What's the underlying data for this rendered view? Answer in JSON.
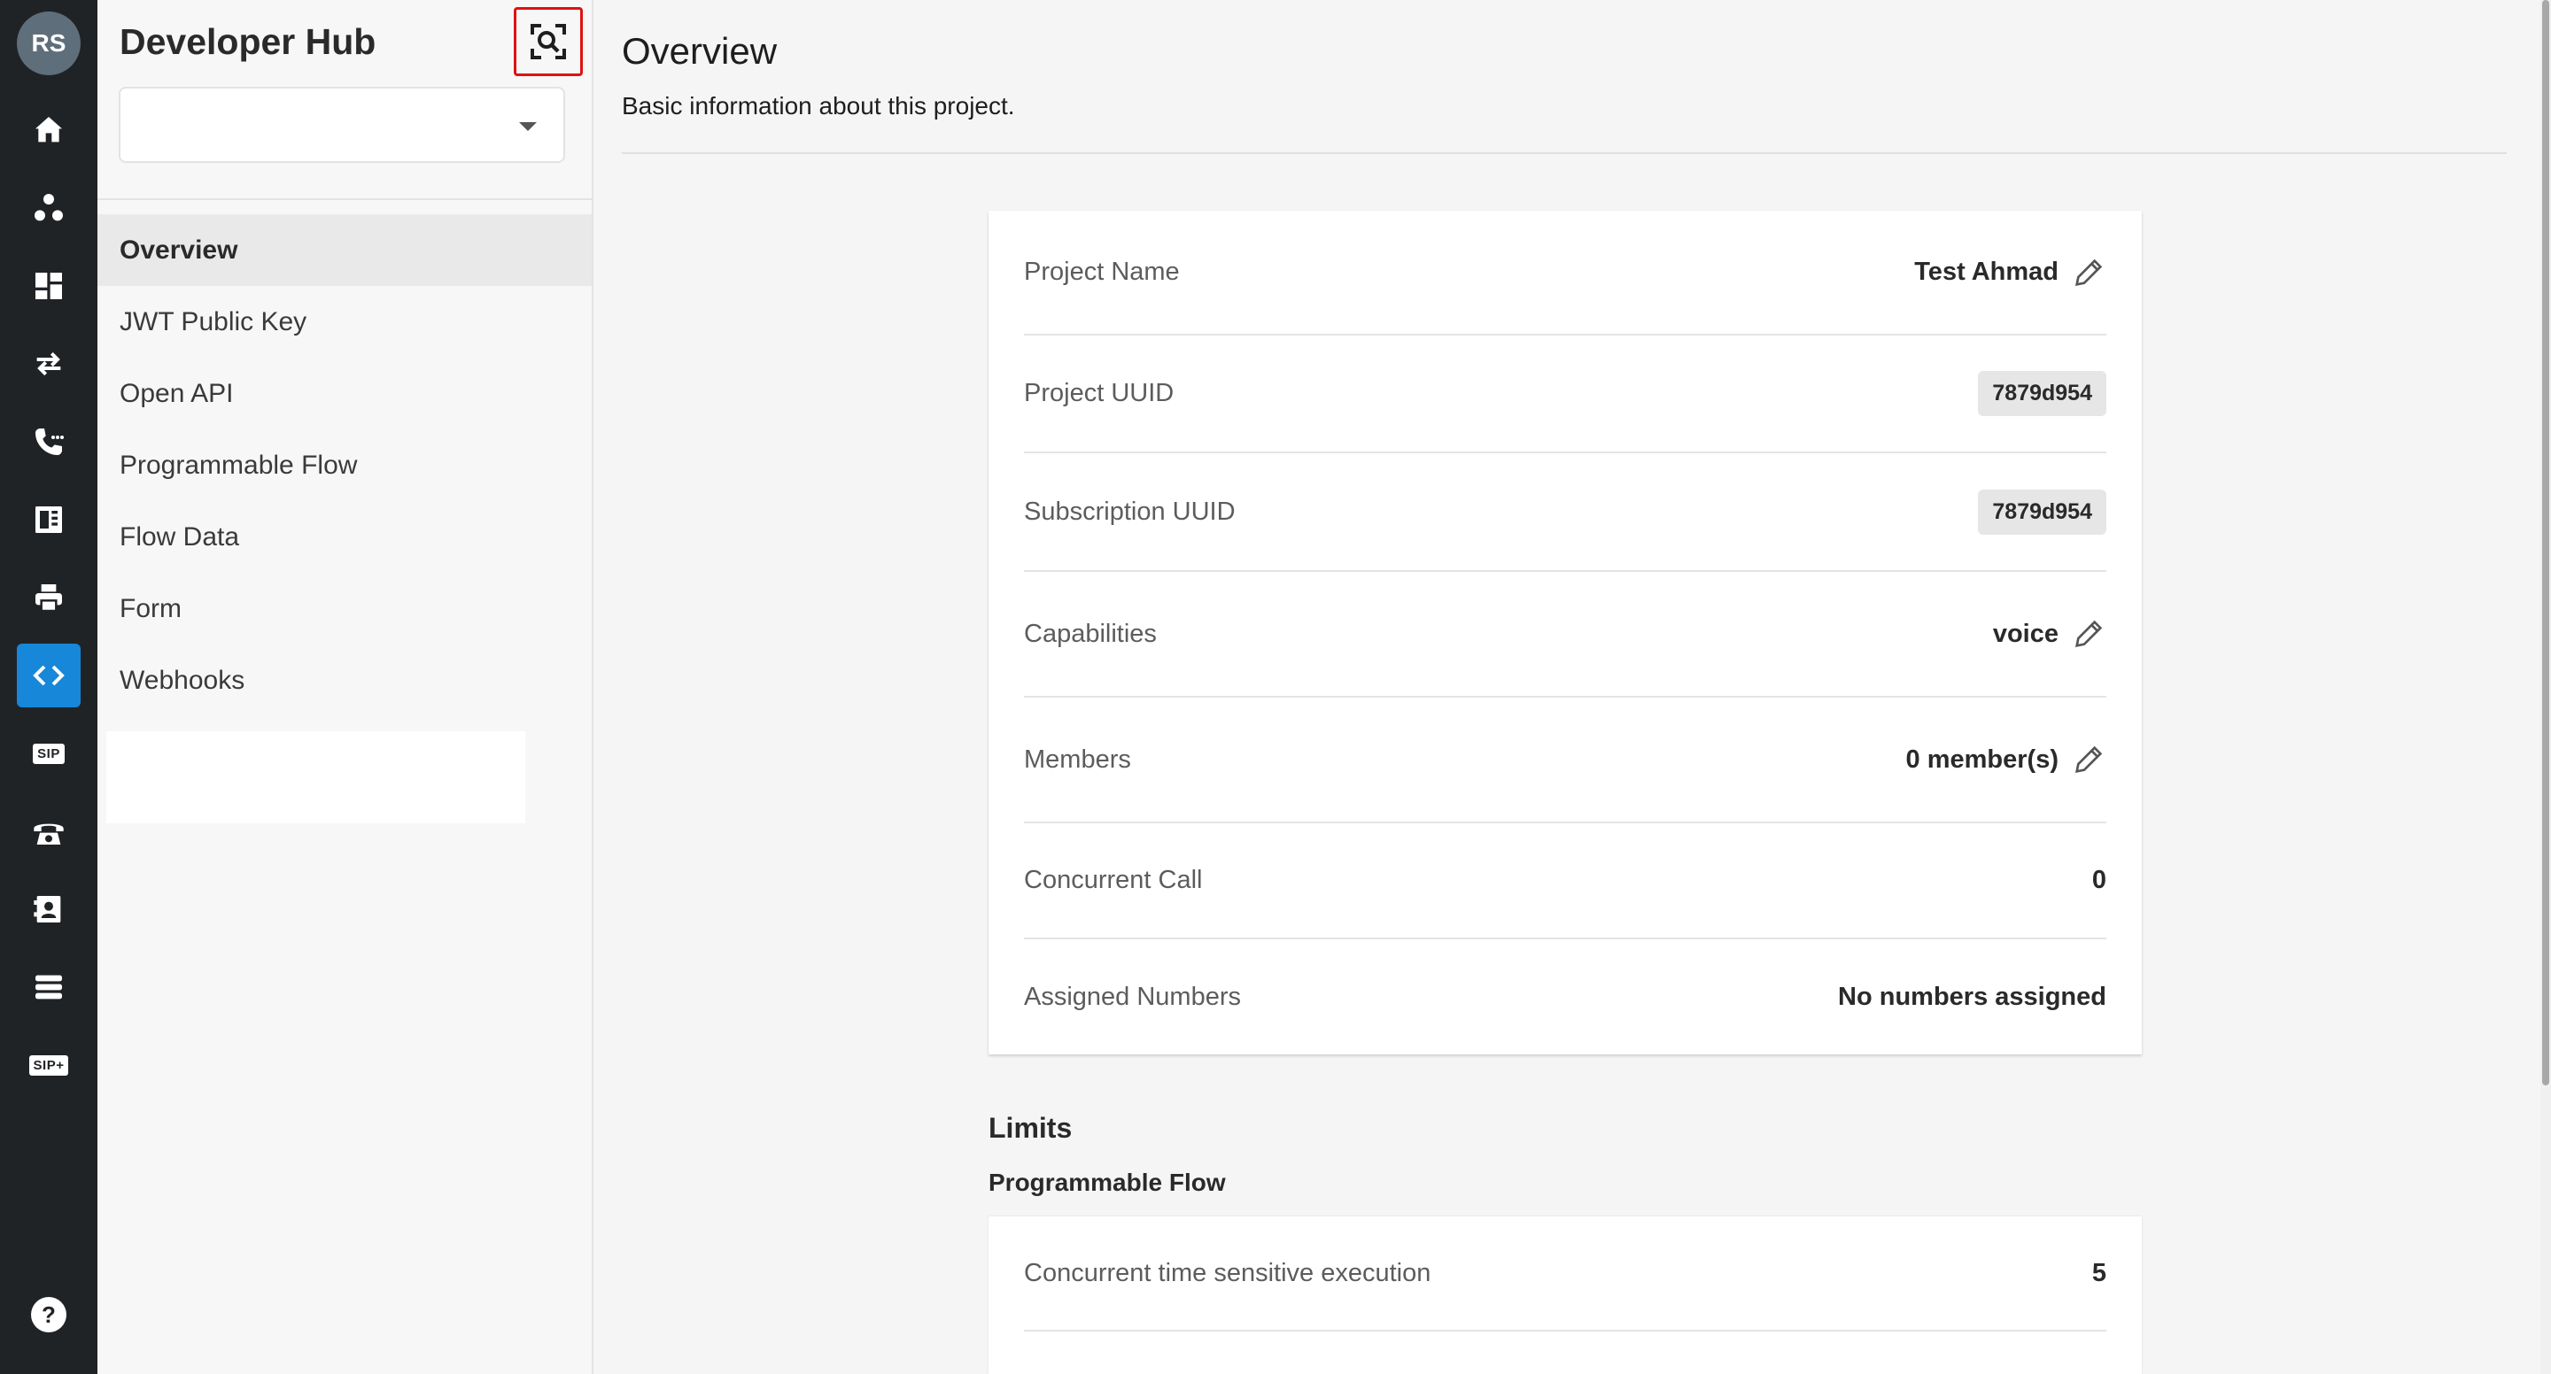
{
  "user": {
    "initials": "RS"
  },
  "rail": {
    "items": [
      {
        "name": "home-icon"
      },
      {
        "name": "group-icon"
      },
      {
        "name": "dashboard-icon"
      },
      {
        "name": "transfer-icon"
      },
      {
        "name": "phone-icon"
      },
      {
        "name": "fax-icon"
      },
      {
        "name": "printer-icon"
      },
      {
        "name": "code-icon",
        "active": true
      },
      {
        "name": "sip-icon",
        "label": "SIP"
      },
      {
        "name": "telephone-icon"
      },
      {
        "name": "contact-icon"
      },
      {
        "name": "list-icon"
      },
      {
        "name": "sip-plus-icon",
        "label": "SIP+"
      }
    ],
    "help_label": "?"
  },
  "sidebar": {
    "title": "Developer Hub",
    "project_select": {
      "value": ""
    },
    "nav": [
      {
        "label": "Overview",
        "active": true
      },
      {
        "label": "JWT Public Key"
      },
      {
        "label": "Open API"
      },
      {
        "label": "Programmable Flow"
      },
      {
        "label": "Flow Data"
      },
      {
        "label": "Form"
      },
      {
        "label": "Webhooks"
      }
    ]
  },
  "main": {
    "title": "Overview",
    "subtitle": "Basic information about this project.",
    "overview_rows": [
      {
        "label": "Project Name",
        "value": "Test Ahmad",
        "editable": true
      },
      {
        "label": "Project UUID",
        "value": "7879d954",
        "chip": true
      },
      {
        "label": "Subscription UUID",
        "value": "7879d954",
        "chip": true
      },
      {
        "label": "Capabilities",
        "value": "voice",
        "editable": true
      },
      {
        "label": "Members",
        "value": "0 member(s)",
        "editable": true
      },
      {
        "label": "Concurrent Call",
        "value": "0"
      },
      {
        "label": "Assigned Numbers",
        "value": "No numbers assigned"
      }
    ],
    "limits": {
      "title": "Limits",
      "subtitle": "Programmable Flow",
      "rows": [
        {
          "label": "Concurrent time sensitive execution",
          "value": "5"
        }
      ]
    }
  },
  "colors": {
    "rail_bg": "#202326",
    "accent": "#1687d9",
    "highlight_border": "#e01212"
  }
}
